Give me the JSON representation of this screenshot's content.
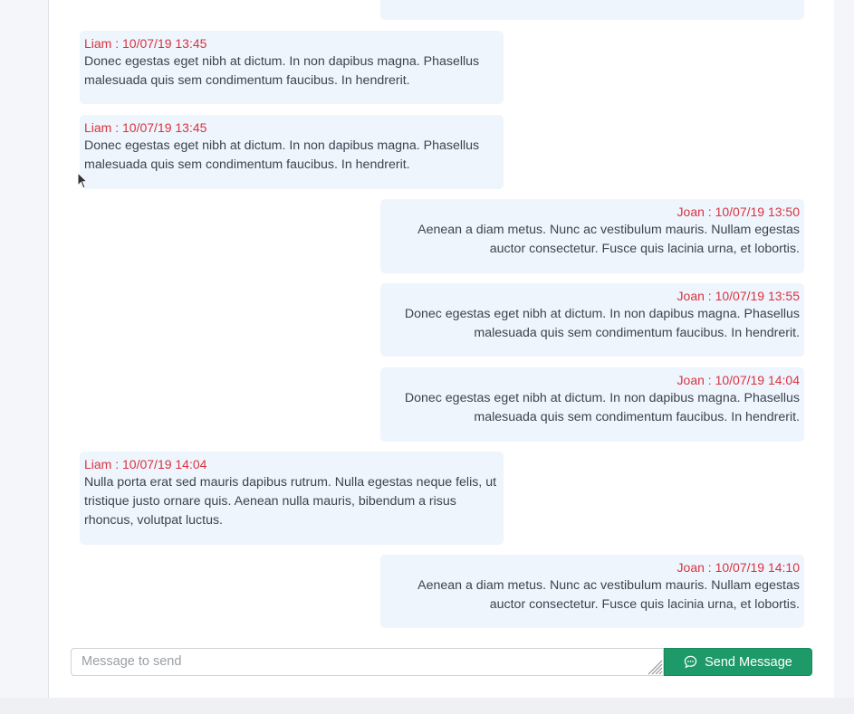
{
  "messages": [
    {
      "side": "right",
      "meta": "",
      "text": "",
      "partial": true
    },
    {
      "side": "left",
      "meta": "Liam : 10/07/19 13:45",
      "text": "Donec egestas eget nibh at dictum. In non dapibus magna. Phasellus malesuada quis sem condimentum faucibus. In hendrerit."
    },
    {
      "side": "left",
      "meta": "Liam : 10/07/19 13:45",
      "text": "Donec egestas eget nibh at dictum. In non dapibus magna. Phasellus malesuada quis sem condimentum faucibus. In hendrerit."
    },
    {
      "side": "right",
      "meta": "Joan : 10/07/19 13:50",
      "text": "Aenean a diam metus. Nunc ac vestibulum mauris. Nullam egestas auctor consectetur. Fusce quis lacinia urna, et lobortis."
    },
    {
      "side": "right",
      "meta": "Joan : 10/07/19 13:55",
      "text": "Donec egestas eget nibh at dictum. In non dapibus magna. Phasellus malesuada quis sem condimentum faucibus. In hendrerit."
    },
    {
      "side": "right",
      "meta": "Joan : 10/07/19 14:04",
      "text": "Donec egestas eget nibh at dictum. In non dapibus magna. Phasellus malesuada quis sem condimentum faucibus. In hendrerit."
    },
    {
      "side": "left",
      "meta": "Liam : 10/07/19 14:04",
      "text": "Nulla porta erat sed mauris dapibus rutrum. Nulla egestas neque felis, ut tristique justo ornare quis. Aenean nulla mauris, bibendum a risus rhoncus, volutpat luctus."
    },
    {
      "side": "right",
      "meta": "Joan : 10/07/19 14:10",
      "text": "Aenean a diam metus. Nunc ac vestibulum mauris. Nullam egestas auctor consectetur. Fusce quis lacinia urna, et lobortis."
    }
  ],
  "composer": {
    "placeholder": "Message to send",
    "value": "",
    "send_label": "Send Message",
    "send_icon": "chat-bubble-icon"
  },
  "colors": {
    "meta_red": "#d9343f",
    "bubble_bg": "#eef5fd",
    "send_green": "#1e9a68"
  }
}
